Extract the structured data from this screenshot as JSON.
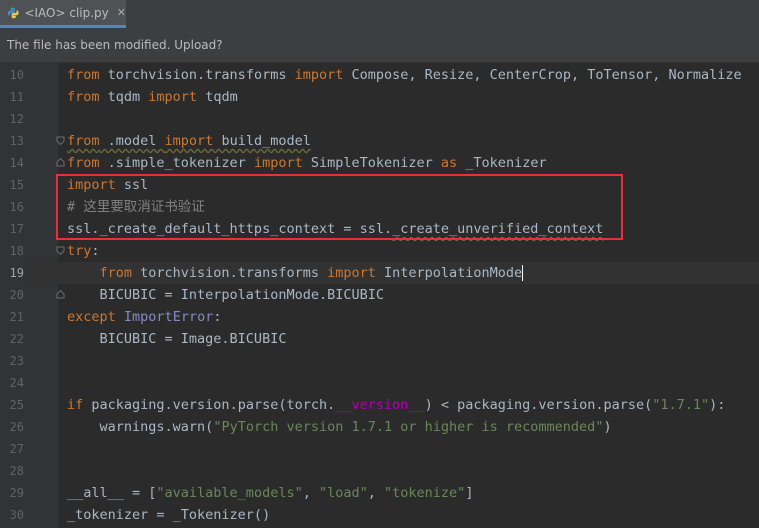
{
  "tab": {
    "label": "<IAO> clip.py",
    "close": "✕"
  },
  "banner": {
    "text": "The file has been modified. Upload?"
  },
  "lines": [
    {
      "n": "10",
      "tokens": [
        [
          "kw",
          "from"
        ],
        [
          "",
          "  torchvision.transforms "
        ],
        [
          "kw",
          "import"
        ],
        [
          "",
          "  Compose, Resize, CenterCrop, ToTensor, Normalize"
        ]
      ]
    },
    {
      "n": "11",
      "tokens": [
        [
          "kw",
          "from"
        ],
        [
          "",
          "  tqdm "
        ],
        [
          "kw",
          "import"
        ],
        [
          "",
          "  tqdm"
        ]
      ]
    },
    {
      "n": "12",
      "tokens": []
    },
    {
      "n": "13",
      "tokens": [
        [
          "kw warn",
          "from"
        ],
        [
          "warn",
          " .model "
        ],
        [
          "kw warn",
          "import"
        ],
        [
          "warn",
          " build_model"
        ]
      ]
    },
    {
      "n": "14",
      "tokens": [
        [
          "kw",
          "from"
        ],
        [
          "",
          " .simple_tokenizer "
        ],
        [
          "kw",
          "import"
        ],
        [
          "",
          " SimpleTokenizer "
        ],
        [
          "kw",
          "as"
        ],
        [
          "",
          " _Tokenizer"
        ]
      ]
    },
    {
      "n": "15",
      "tokens": [
        [
          "kw",
          "import"
        ],
        [
          "",
          " ssl"
        ]
      ]
    },
    {
      "n": "16",
      "tokens": [
        [
          "cmt",
          "# 这里要取消证书验证"
        ]
      ]
    },
    {
      "n": "17",
      "tokens": [
        [
          "",
          "ssl._create_default_https_context = ssl."
        ],
        [
          "warn",
          "_create_unverified_context"
        ]
      ]
    },
    {
      "n": "18",
      "tokens": [
        [
          "kw",
          "try"
        ],
        [
          "",
          ":"
        ]
      ]
    },
    {
      "n": "19",
      "tokens": [
        [
          "",
          "    "
        ],
        [
          "kw",
          "from"
        ],
        [
          "",
          " torchvision.transforms "
        ],
        [
          "kw",
          "import"
        ],
        [
          "",
          " InterpolationMode"
        ]
      ]
    },
    {
      "n": "20",
      "tokens": [
        [
          "",
          "    BICUBIC = InterpolationMode.BICUBIC"
        ]
      ]
    },
    {
      "n": "21",
      "tokens": [
        [
          "kw",
          "except"
        ],
        [
          "",
          " "
        ],
        [
          "cls",
          "ImportError"
        ],
        [
          "",
          ":"
        ]
      ]
    },
    {
      "n": "22",
      "tokens": [
        [
          "",
          "    BICUBIC = Image.BICUBIC"
        ]
      ]
    },
    {
      "n": "23",
      "tokens": []
    },
    {
      "n": "24",
      "tokens": []
    },
    {
      "n": "25",
      "tokens": [
        [
          "kw",
          "if"
        ],
        [
          "",
          " packaging.version.parse(torch."
        ],
        [
          "dunder",
          "__version__"
        ],
        [
          "",
          ") < packaging.version.parse("
        ],
        [
          "str",
          "\"1.7.1\""
        ],
        [
          "",
          "):"
        ]
      ]
    },
    {
      "n": "26",
      "tokens": [
        [
          "",
          "    warnings.warn("
        ],
        [
          "str",
          "\"PyTorch version 1.7.1 or higher is recommended\""
        ],
        [
          "",
          ")"
        ]
      ]
    },
    {
      "n": "27",
      "tokens": []
    },
    {
      "n": "28",
      "tokens": []
    },
    {
      "n": "29",
      "tokens": [
        [
          "",
          "__all__ = ["
        ],
        [
          "str",
          "\"available_models\""
        ],
        [
          "",
          ", "
        ],
        [
          "str",
          "\"load\""
        ],
        [
          "",
          ", "
        ],
        [
          "str",
          "\"tokenize\""
        ],
        [
          "",
          "]"
        ]
      ]
    },
    {
      "n": "30",
      "tokens": [
        [
          "",
          "_tokenizer = _Tokenizer()"
        ]
      ]
    }
  ],
  "current_line": "19",
  "colors": {
    "highlight_box": "#e8303a",
    "keyword": "#cc7832",
    "string": "#6a8759"
  }
}
